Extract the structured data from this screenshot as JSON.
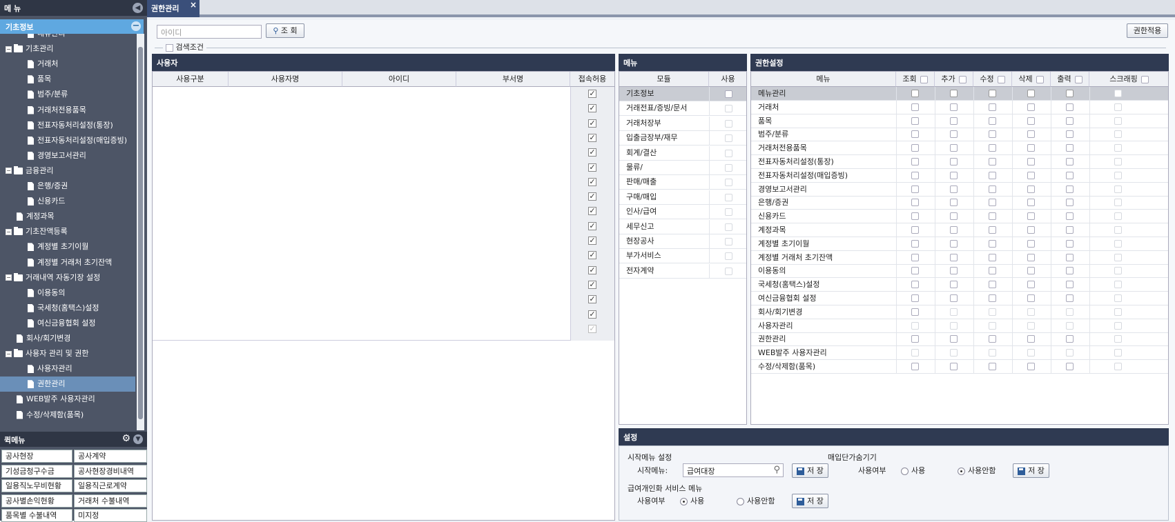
{
  "sidebar": {
    "title": "메 뉴",
    "tree_title": "기초정보",
    "items": [
      {
        "label": "메뉴관리",
        "type": "doc",
        "level": 1
      },
      {
        "label": "기초관리",
        "type": "folder",
        "level": 0
      },
      {
        "label": "거래처",
        "type": "doc",
        "level": 1
      },
      {
        "label": "품목",
        "type": "doc",
        "level": 1
      },
      {
        "label": "범주/분류",
        "type": "doc",
        "level": 1
      },
      {
        "label": "거래처전용품목",
        "type": "doc",
        "level": 1
      },
      {
        "label": "전표자동처리설정(통장)",
        "type": "doc",
        "level": 1
      },
      {
        "label": "전표자동처리설정(매입증빙)",
        "type": "doc",
        "level": 1
      },
      {
        "label": "경영보고서관리",
        "type": "doc",
        "level": 1
      },
      {
        "label": "금융관리",
        "type": "folder",
        "level": 0
      },
      {
        "label": "은행/증권",
        "type": "doc",
        "level": 1
      },
      {
        "label": "신용카드",
        "type": "doc",
        "level": 1
      },
      {
        "label": "계정과목",
        "type": "doc",
        "level": 0
      },
      {
        "label": "기초잔액등록",
        "type": "folder",
        "level": 0
      },
      {
        "label": "계정별 초기이월",
        "type": "doc",
        "level": 1
      },
      {
        "label": "계정별 거래처 초기잔액",
        "type": "doc",
        "level": 1
      },
      {
        "label": "거래내역 자동기장 설정",
        "type": "folder",
        "level": 0
      },
      {
        "label": "이용동의",
        "type": "doc",
        "level": 1
      },
      {
        "label": "국세청(홈택스)설정",
        "type": "doc",
        "level": 1
      },
      {
        "label": "여신금융협회 설정",
        "type": "doc",
        "level": 1
      },
      {
        "label": "회사/회기변경",
        "type": "doc",
        "level": 0
      },
      {
        "label": "사용자 관리 및 권한",
        "type": "folder",
        "level": 0
      },
      {
        "label": "사용자관리",
        "type": "doc",
        "level": 1
      },
      {
        "label": "권한관리",
        "type": "doc",
        "level": 1,
        "selected": true
      },
      {
        "label": "WEB발주 사용자관리",
        "type": "doc",
        "level": 0
      },
      {
        "label": "수정/삭제함(품목)",
        "type": "doc",
        "level": 0
      }
    ],
    "quick_title": "퀵메뉴",
    "quick": [
      "공사현장",
      "공사계약",
      "기성금청구수금",
      "공사현장경비내역",
      "일용직노무비현황",
      "일용직근로계약",
      "공사별손익현황",
      "거래처 수불내역",
      "품목별 수불내역",
      "미지정"
    ]
  },
  "tabs": [
    {
      "label": "권한관리",
      "close": "×"
    }
  ],
  "toolbar": {
    "id_placeholder": "아이디",
    "search_label": "조 회",
    "apply_label": "권한적용",
    "search_cond_label": "검색조건"
  },
  "user_panel": {
    "title": "사용자",
    "columns": [
      "사용구분",
      "사용자명",
      "아이디",
      "부서명",
      "접속허용"
    ],
    "checks": [
      true,
      true,
      true,
      true,
      true,
      true,
      true,
      true,
      true,
      true,
      true,
      true,
      true,
      true,
      true,
      true,
      true
    ]
  },
  "menu_panel": {
    "title": "메뉴",
    "columns": [
      "모듈",
      "사용"
    ],
    "rows": [
      "기초정보",
      "거래전표/증빙/문서",
      "거래처장부",
      "입출금장부/재무",
      "회계/결산",
      "물류/",
      "판매/매출",
      "구매/매입",
      "인사/급여",
      "세무신고",
      "현장공사",
      "부가서비스",
      "전자계약"
    ]
  },
  "perm_panel": {
    "title": "권한설정",
    "columns": [
      "메뉴",
      "조회",
      "추가",
      "수정",
      "삭제",
      "출력",
      "스크래핑"
    ],
    "rows": [
      "메뉴관리",
      "거래처",
      "품목",
      "범주/분류",
      "거래처전용품목",
      "전표자동처리설정(통장)",
      "전표자동처리설정(매입증빙)",
      "경영보고서관리",
      "은행/증권",
      "신용카드",
      "계정과목",
      "계정별 초기이월",
      "계정별 거래처 초기잔액",
      "이용동의",
      "국세청(홈택스)설정",
      "여신금융협회 설정",
      "회사/회기변경",
      "사용자관리",
      "권한관리",
      "WEB발주 사용자관리",
      "수정/삭제함(품목)"
    ]
  },
  "settings": {
    "title": "설정",
    "start_menu_section": "시작메뉴 설정",
    "start_menu_label": "시작메뉴:",
    "start_menu_value": "급여대장",
    "save_label": "저 장",
    "purchase_section": "매입단가숨기기",
    "use_label": "사용여부",
    "opt_use": "사용",
    "opt_nouse": "사용안함",
    "payroll_section": "급여개인화 서비스 메뉴"
  }
}
